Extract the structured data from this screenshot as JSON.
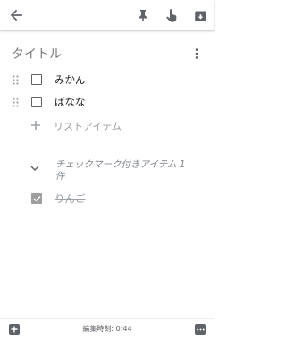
{
  "toolbar": {
    "back_icon": "arrow-back-icon",
    "pin_icon": "pin-icon",
    "reminder_icon": "reminder-hand-icon",
    "archive_icon": "archive-icon"
  },
  "note": {
    "title": "タイトル",
    "more_icon": "more-vert-icon",
    "items": [
      {
        "label": "みかん",
        "checked": false
      },
      {
        "label": "ばなな",
        "checked": false
      }
    ],
    "add_item_label": "リストアイテム",
    "completed": {
      "header": "チェックマーク付きアイテム 1 件",
      "items": [
        {
          "label": "りんご",
          "checked": true
        }
      ]
    }
  },
  "bottombar": {
    "edited_text": "編集時刻: 0:44",
    "add_icon": "add-box-icon",
    "more_icon": "more-horiz-icon"
  },
  "colors": {
    "icon": "#5f6368",
    "muted_text": "#9aa0a6",
    "checked_box": "#9e9e9e"
  }
}
